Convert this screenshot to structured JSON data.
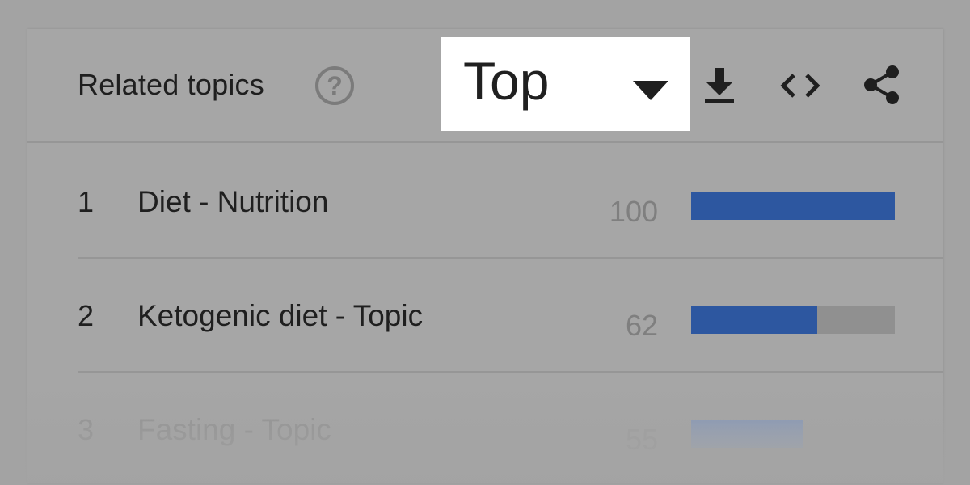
{
  "header": {
    "title": "Related topics",
    "help_glyph": "?",
    "dropdown": {
      "selected": "Top"
    },
    "icons": [
      "download-icon",
      "embed-code-icon",
      "share-icon"
    ]
  },
  "rows": [
    {
      "rank": "1",
      "label": "Diet - Nutrition",
      "value": "100",
      "bar_fraction": 1.0
    },
    {
      "rank": "2",
      "label": "Ketogenic diet - Topic",
      "value": "62",
      "bar_fraction": 0.62
    },
    {
      "rank": "3",
      "label": "Fasting - Topic",
      "value": "55",
      "bar_fraction": 0.55
    }
  ],
  "colors": {
    "background": "#a3a3a3",
    "bar": "#2d57a0",
    "bar_track": "#909090",
    "dropdown_bg": "#ffffff"
  }
}
